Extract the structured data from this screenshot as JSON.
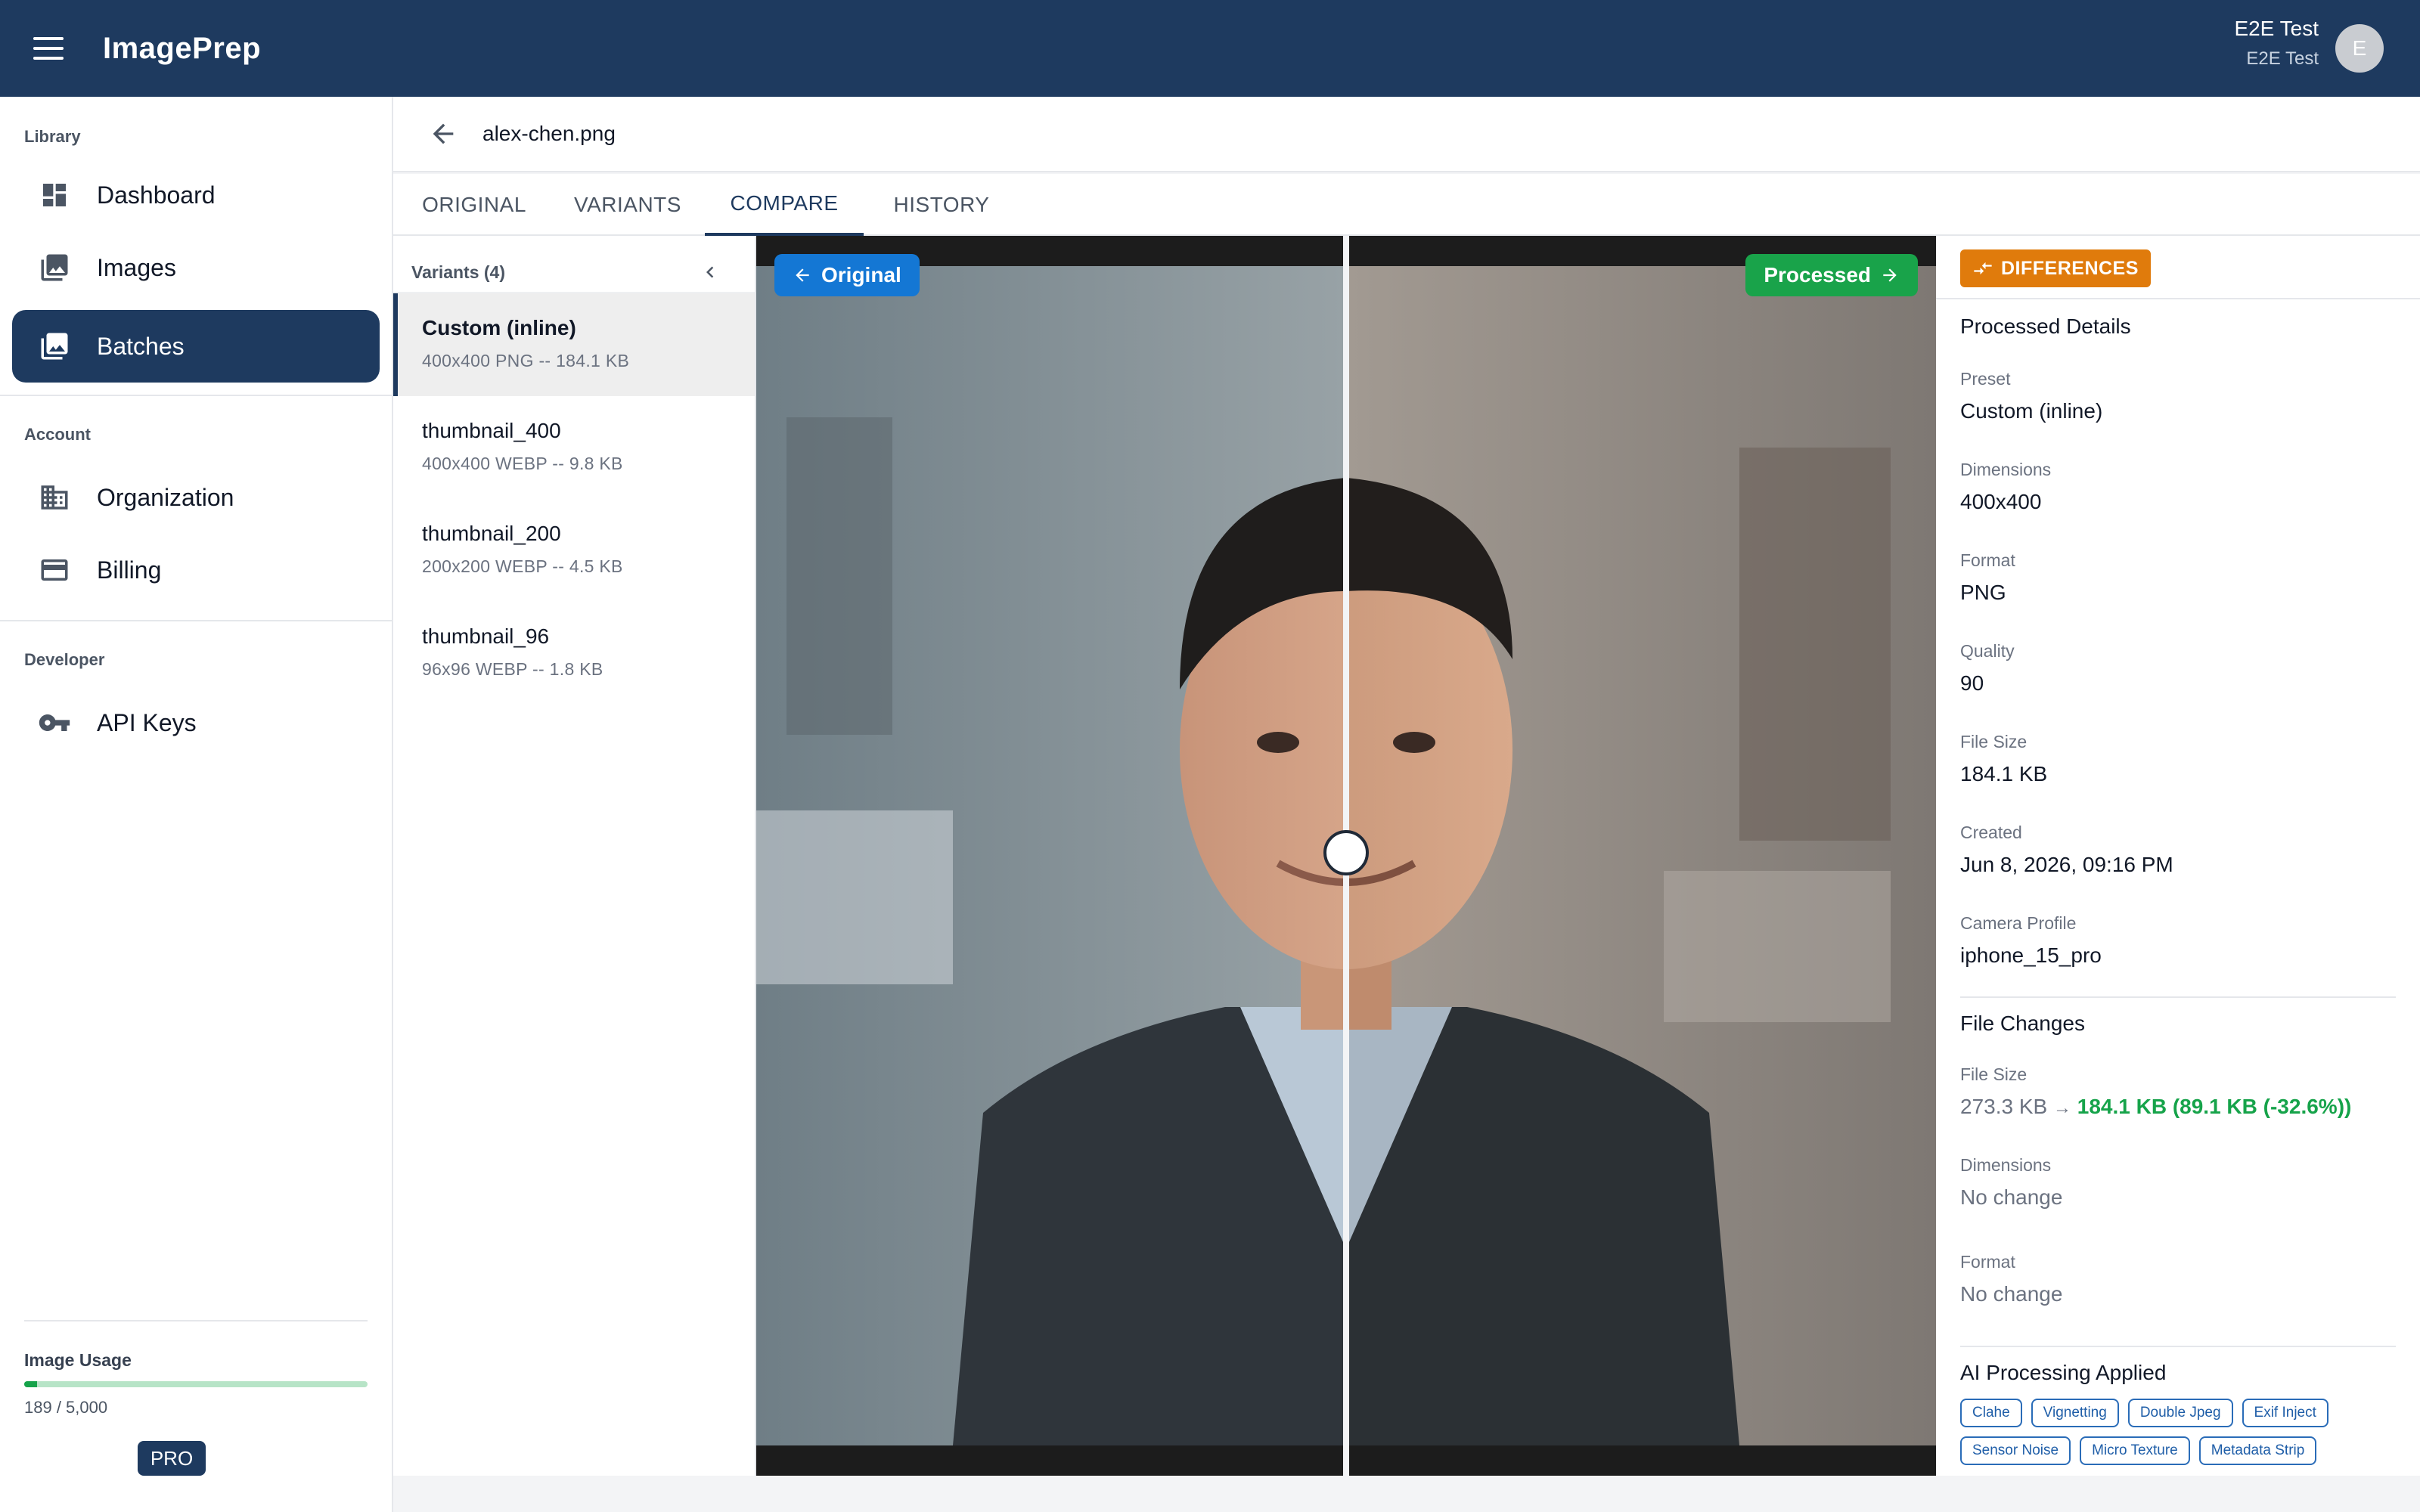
{
  "app": {
    "title": "ImagePrep"
  },
  "user": {
    "name": "E2E Test",
    "sub": "E2E Test",
    "initial": "E"
  },
  "sidebar": {
    "sections": [
      {
        "title": "Library",
        "items": [
          {
            "label": "Dashboard",
            "icon": "dashboard-icon"
          },
          {
            "label": "Images",
            "icon": "image-icon"
          },
          {
            "label": "Batches",
            "icon": "batch-icon",
            "active": true
          }
        ]
      },
      {
        "title": "Account",
        "items": [
          {
            "label": "Organization",
            "icon": "building-icon"
          },
          {
            "label": "Billing",
            "icon": "credit-card-icon"
          }
        ]
      },
      {
        "title": "Developer",
        "items": [
          {
            "label": "API Keys",
            "icon": "key-icon"
          }
        ]
      }
    ],
    "usage": {
      "title": "Image Usage",
      "count": "189 / 5,000",
      "used": 189,
      "limit": 5000
    },
    "plan": "PRO"
  },
  "file": {
    "name": "alex-chen.png"
  },
  "tabs": [
    {
      "label": "ORIGINAL"
    },
    {
      "label": "VARIANTS"
    },
    {
      "label": "COMPARE",
      "active": true
    },
    {
      "label": "HISTORY"
    }
  ],
  "variants": {
    "title": "Variants (4)",
    "items": [
      {
        "name": "Custom (inline)",
        "meta": "400x400 PNG -- 184.1 KB",
        "active": true
      },
      {
        "name": "thumbnail_400",
        "meta": "400x400 WEBP -- 9.8 KB"
      },
      {
        "name": "thumbnail_200",
        "meta": "200x200 WEBP -- 4.5 KB"
      },
      {
        "name": "thumbnail_96",
        "meta": "96x96 WEBP -- 1.8 KB"
      }
    ]
  },
  "compare": {
    "left_label": "Original",
    "right_label": "Processed"
  },
  "differences": {
    "badge": "DIFFERENCES",
    "processed_title": "Processed Details",
    "details": [
      {
        "label": "Preset",
        "value": "Custom (inline)"
      },
      {
        "label": "Dimensions",
        "value": "400x400"
      },
      {
        "label": "Format",
        "value": "PNG"
      },
      {
        "label": "Quality",
        "value": "90"
      },
      {
        "label": "File Size",
        "value": "184.1 KB"
      },
      {
        "label": "Created",
        "value": "Jun 8, 2026, 09:16 PM"
      },
      {
        "label": "Camera Profile",
        "value": "iphone_15_pro"
      }
    ],
    "changes_title": "File Changes",
    "file_size_label": "File Size",
    "file_size_old": "273.3 KB",
    "file_size_new": "184.1 KB (89.1 KB (-32.6%))",
    "dimensions_label": "Dimensions",
    "dimensions_value": "No change",
    "format_label": "Format",
    "format_value": "No change",
    "ai_title": "AI Processing Applied",
    "ai_chips": [
      "Clahe",
      "Vignetting",
      "Double Jpeg",
      "Exif Inject",
      "Sensor Noise",
      "Micro Texture",
      "Metadata Strip"
    ]
  },
  "colors": {
    "primary": "#1e3a5f",
    "original_pill": "#1477d4",
    "processed_pill": "#19a34a",
    "diff_badge": "#e07b0c",
    "positive": "#16a34a"
  }
}
